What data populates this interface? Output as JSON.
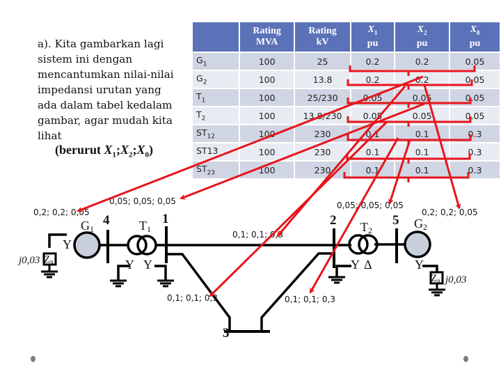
{
  "intro": {
    "lines": [
      "a). Kita gambarkan lagi",
      "sistem ini dengan",
      "mencantumkan nilai-nilai",
      "impedansi urutan yang",
      "ada dalam tabel kedalam",
      "gambar, agar mudah kita",
      "lihat"
    ],
    "order_prefix": "(berurut ",
    "order_x1": "X",
    "order_x1_sub": "1",
    "order_x2": "X",
    "order_x2_sub": "2",
    "order_x0": "X",
    "order_x0_sub": "0",
    "order_sep": ";",
    "order_suffix": ")"
  },
  "table": {
    "headers": [
      {
        "line1": "",
        "line2": ""
      },
      {
        "line1": "Rating",
        "line2": "MVA"
      },
      {
        "line1": "Rating",
        "line2": "kV"
      },
      {
        "line1": "X",
        "sub": "1",
        "line2": "pu"
      },
      {
        "line1": "X",
        "sub": "2",
        "line2": "pu"
      },
      {
        "line1": "X",
        "sub": "0",
        "line2": "pu"
      }
    ],
    "rows": [
      {
        "name": "G",
        "sub": "1",
        "mva": "100",
        "kv": "25",
        "x1": "0.2",
        "x2": "0.2",
        "x0": "0.05"
      },
      {
        "name": "G",
        "sub": "2",
        "mva": "100",
        "kv": "13.8",
        "x1": "0.2",
        "x2": "0.2",
        "x0": "0.05"
      },
      {
        "name": "T",
        "sub": "1",
        "mva": "100",
        "kv": "25/230",
        "x1": "0.05",
        "x2": "0.05",
        "x0": "0.05"
      },
      {
        "name": "T",
        "sub": "2",
        "mva": "100",
        "kv": "13.8/230",
        "x1": "0.05",
        "x2": "0.05",
        "x0": "0.05"
      },
      {
        "name": "ST",
        "sub": "12",
        "mva": "100",
        "kv": "230",
        "x1": "0.1",
        "x2": "0.1",
        "x0": "0.3"
      },
      {
        "name": "ST13",
        "sub": "",
        "mva": "100",
        "kv": "230",
        "x1": "0.1",
        "x2": "0.1",
        "x0": "0.3"
      },
      {
        "name": "ST",
        "sub": "23",
        "mva": "100",
        "kv": "230",
        "x1": "0.1",
        "x2": "0.1",
        "x0": "0.3"
      }
    ]
  },
  "diagram": {
    "buses": {
      "b1": "1",
      "b2": "2",
      "b3": "3",
      "b4": "4",
      "b5": "5"
    },
    "labels": {
      "g1_imp": "0,2; 0,2; 0,05",
      "t1_imp": "0,05; 0,05; 0,05",
      "line12_imp": "0,1; 0,1; 0,3",
      "t2_imp": "0,05; 0,05; 0,05",
      "g2_imp": "0,2; 0,2; 0,05",
      "line13_imp": "0,1; 0,1; 0,3",
      "line23_imp": "0,1; 0,1; 0,3"
    },
    "components": {
      "g1": "G",
      "g1_sub": "1",
      "t1": "T",
      "t1_sub": "1",
      "t2": "T",
      "t2_sub": "2",
      "g2": "G",
      "g2_sub": "2",
      "zn": "Z",
      "zn_sub": "n",
      "zn_value_left": "j0,03",
      "zn_value_right": "j0,03"
    },
    "winding": {
      "wye": "Y",
      "delta": "Δ"
    },
    "colors": {
      "arrow": "#e8141c",
      "generator_fill": "#c9d0dc",
      "line": "#000000",
      "header_bg": "#5b72b8"
    }
  }
}
